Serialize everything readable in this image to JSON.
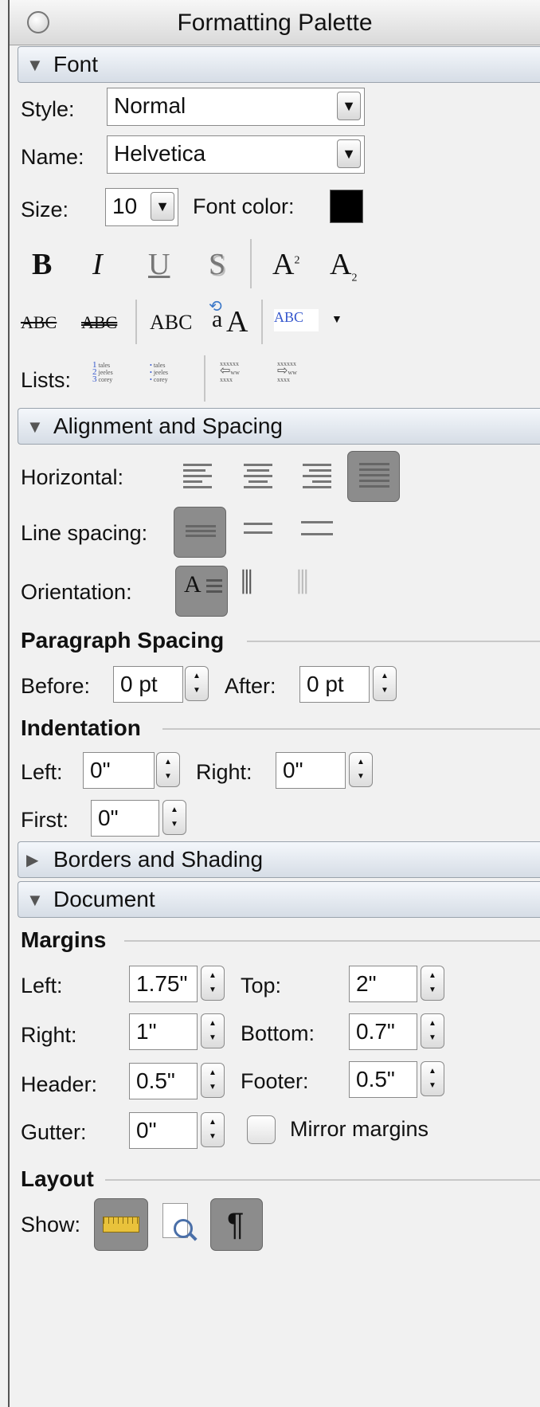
{
  "window": {
    "title": "Formatting Palette"
  },
  "sections": {
    "font": "Font",
    "alignment": "Alignment and Spacing",
    "borders": "Borders and Shading",
    "document": "Document"
  },
  "font": {
    "style_label": "Style:",
    "style_value": "Normal",
    "name_label": "Name:",
    "name_value": "Helvetica",
    "size_label": "Size:",
    "size_value": "10",
    "font_color_label": "Font color:",
    "font_color": "#000000",
    "bold": "B",
    "italic": "I",
    "underline": "U",
    "shadow": "S",
    "superscript_base": "A",
    "superscript_mark": "2",
    "subscript_base": "A",
    "subscript_mark": "2",
    "strike": "ABC",
    "double_strike": "ABC",
    "small_caps": "ABC",
    "all_caps_top": "a",
    "all_caps_bottom": "A",
    "highlight": "ABC",
    "lists_label": "Lists:",
    "list_items": [
      "tales",
      "jeeles",
      "corey"
    ],
    "indent_items": [
      "xxxxxx",
      "ww",
      "xxxx"
    ]
  },
  "alignment": {
    "horizontal_label": "Horizontal:",
    "line_spacing_label": "Line spacing:",
    "orientation_label": "Orientation:",
    "orientation_glyph": "A",
    "paragraph_spacing_label": "Paragraph Spacing",
    "before_label": "Before:",
    "before_value": "0 pt",
    "after_label": "After:",
    "after_value": "0 pt",
    "indentation_label": "Indentation",
    "left_label": "Left:",
    "left_value": "0\"",
    "right_label": "Right:",
    "right_value": "0\"",
    "first_label": "First:",
    "first_value": "0\""
  },
  "document": {
    "margins_label": "Margins",
    "left_label": "Left:",
    "left_value": "1.75\"",
    "top_label": "Top:",
    "top_value": "2\"",
    "right_label": "Right:",
    "right_value": "1\"",
    "bottom_label": "Bottom:",
    "bottom_value": "0.7\"",
    "header_label": "Header:",
    "header_value": "0.5\"",
    "footer_label": "Footer:",
    "footer_value": "0.5\"",
    "gutter_label": "Gutter:",
    "gutter_value": "0\"",
    "mirror_label": "Mirror margins",
    "layout_label": "Layout",
    "show_label": "Show:",
    "paragraph_mark": "¶"
  },
  "colors": {
    "highlight": "#3355cc",
    "ruler": "#e9c23b"
  }
}
